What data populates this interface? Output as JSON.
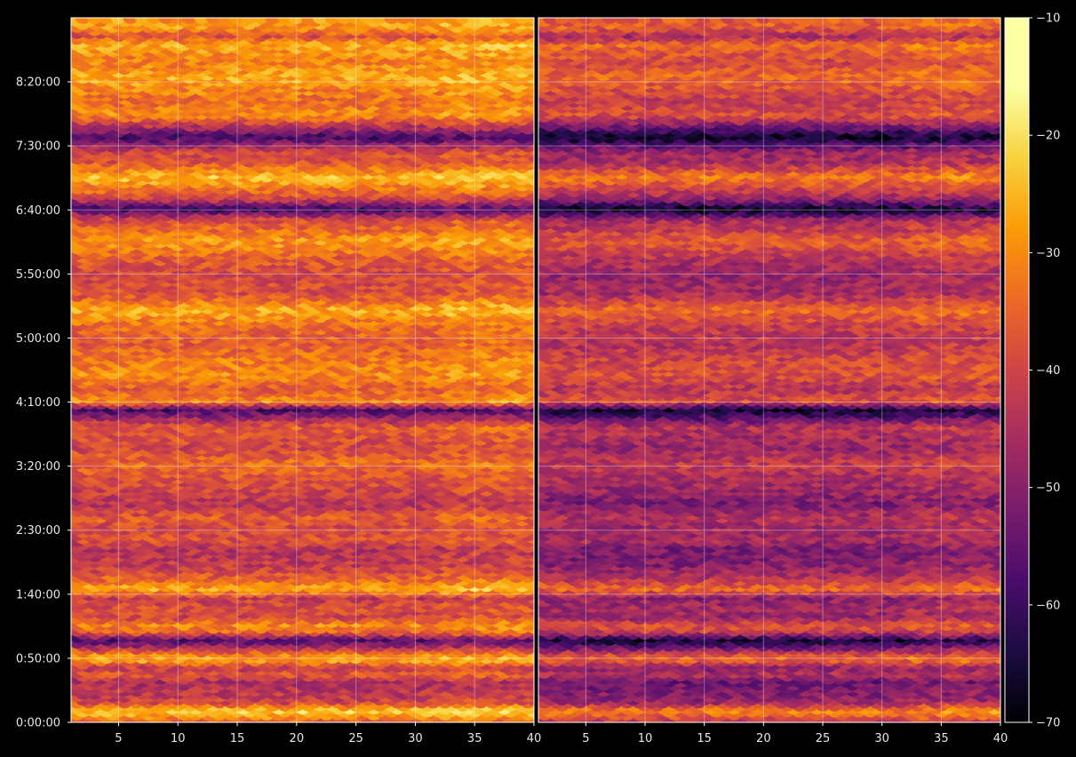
{
  "chart_data": {
    "type": "heatmap",
    "title": "",
    "xlabel": "",
    "ylabel": "",
    "panels": [
      {
        "name": "",
        "xlim": [
          1,
          40
        ],
        "x_ticks": [
          5,
          10,
          15,
          20,
          25,
          30,
          35,
          40
        ],
        "x_tick_labels": [
          "5",
          "10",
          "15",
          "20",
          "25",
          "30",
          "35",
          "40"
        ]
      },
      {
        "name": "",
        "xlim": [
          1,
          40
        ],
        "x_ticks": [
          5,
          10,
          15,
          20,
          25,
          30,
          35,
          40
        ],
        "x_tick_labels": [
          "5",
          "10",
          "15",
          "20",
          "25",
          "30",
          "35",
          "40"
        ]
      }
    ],
    "y_seconds_range": [
      0,
      33000
    ],
    "y_ticks": [
      0,
      3000,
      6000,
      9000,
      12000,
      15000,
      18000,
      21000,
      24000,
      27000,
      30000
    ],
    "y_tick_labels": [
      "0:00:00",
      "0:50:00",
      "1:40:00",
      "2:30:00",
      "3:20:00",
      "4:10:00",
      "5:00:00",
      "5:50:00",
      "6:40:00",
      "7:30:00",
      "8:20:00"
    ],
    "grid": true,
    "colormap": "inferno",
    "colorbar": {
      "vmin": -70,
      "vmax": -10,
      "ticks": [
        -70,
        -60,
        -50,
        -40,
        -30,
        -20,
        -10
      ],
      "tick_labels": [
        "−70",
        "−60",
        "−50",
        "−40",
        "−30",
        "−20",
        "−10"
      ]
    },
    "row_profile": {
      "description_free": true,
      "time_seconds": [
        0,
        600,
        1000,
        1300,
        2000,
        2300,
        2600,
        3000,
        3200,
        3900,
        4300,
        4600,
        5000,
        5400,
        5900,
        6300,
        6700,
        7400,
        8200,
        8600,
        9200,
        9600,
        10300,
        10900,
        11500,
        12200,
        12900,
        13900,
        14700,
        15100,
        15700,
        16300,
        17000,
        17800,
        18600,
        19400,
        20100,
        21000,
        21800,
        22600,
        23100,
        23600,
        24100,
        24600,
        25600,
        26300,
        26800,
        27500,
        27900,
        28500,
        29200,
        30300,
        31000,
        31800,
        32200,
        32600
      ],
      "level_dB": [
        -38,
        -22,
        -40,
        -42,
        -46,
        -36,
        -42,
        -26,
        -30,
        -58,
        -34,
        -30,
        -40,
        -38,
        -42,
        -26,
        -34,
        -42,
        -44,
        -38,
        -40,
        -36,
        -44,
        -40,
        -38,
        -34,
        -40,
        -36,
        -58,
        -30,
        -36,
        -30,
        -32,
        -36,
        -34,
        -26,
        -38,
        -40,
        -36,
        -28,
        -34,
        -38,
        -60,
        -40,
        -24,
        -38,
        -40,
        -60,
        -46,
        -30,
        -34,
        -26,
        -32,
        -26,
        -38,
        -28
      ]
    },
    "panel_offset_dB": [
      0,
      -8
    ]
  }
}
